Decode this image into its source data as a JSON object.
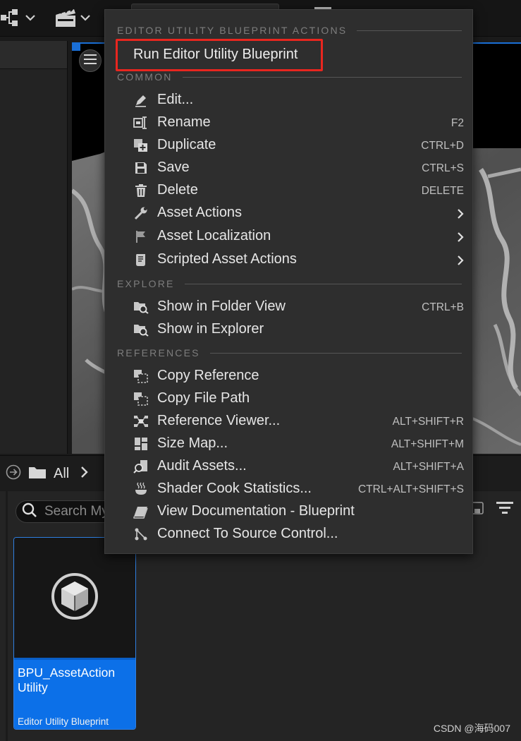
{
  "toolbar": {
    "blueprint_icon": "blueprint-graph-icon",
    "cinematics_icon": "clapperboard-icon"
  },
  "viewport": {
    "menu_icon": "hamburger-menu-icon"
  },
  "context_menu": {
    "sections": {
      "editor_utility": "EDITOR UTILITY BLUEPRINT ACTIONS",
      "common": "COMMON",
      "explore": "EXPLORE",
      "references": "REFERENCES"
    },
    "run_item": {
      "label": "Run Editor Utility Blueprint",
      "highlight_color": "#e8261f"
    },
    "common_items": [
      {
        "label": "Edit...",
        "shortcut": "",
        "icon": "pencil-icon"
      },
      {
        "label": "Rename",
        "shortcut": "F2",
        "icon": "rename-icon"
      },
      {
        "label": "Duplicate",
        "shortcut": "CTRL+D",
        "icon": "duplicate-icon"
      },
      {
        "label": "Save",
        "shortcut": "CTRL+S",
        "icon": "save-icon"
      },
      {
        "label": "Delete",
        "shortcut": "DELETE",
        "icon": "trash-icon"
      },
      {
        "label": "Asset Actions",
        "shortcut": "",
        "icon": "wrench-icon",
        "submenu": true
      },
      {
        "label": "Asset Localization",
        "shortcut": "",
        "icon": "flag-icon",
        "submenu": true
      },
      {
        "label": "Scripted Asset Actions",
        "shortcut": "",
        "icon": "script-icon",
        "submenu": true
      }
    ],
    "explore_items": [
      {
        "label": "Show in Folder View",
        "shortcut": "CTRL+B",
        "icon": "folder-search-icon"
      },
      {
        "label": "Show in Explorer",
        "shortcut": "",
        "icon": "folder-search-icon"
      }
    ],
    "reference_items": [
      {
        "label": "Copy Reference",
        "shortcut": "",
        "icon": "copy-reference-icon"
      },
      {
        "label": "Copy File Path",
        "shortcut": "",
        "icon": "copy-path-icon"
      },
      {
        "label": "Reference Viewer...",
        "shortcut": "ALT+SHIFT+R",
        "icon": "reference-viewer-icon"
      },
      {
        "label": "Size Map...",
        "shortcut": "ALT+SHIFT+M",
        "icon": "size-map-icon"
      },
      {
        "label": "Audit Assets...",
        "shortcut": "ALT+SHIFT+A",
        "icon": "audit-icon"
      },
      {
        "label": "Shader Cook Statistics...",
        "shortcut": "CTRL+ALT+SHIFT+S",
        "icon": "shader-cook-icon"
      },
      {
        "label": "View Documentation - Blueprint",
        "shortcut": "",
        "icon": "documentation-icon"
      },
      {
        "label": "Connect To Source Control...",
        "shortcut": "",
        "icon": "source-control-icon"
      }
    ]
  },
  "content_browser": {
    "path_label": "All",
    "search_placeholder": "Search My",
    "asset": {
      "name": "BPU_AssetAction Utility",
      "type": "Editor Utility Blueprint",
      "accent": "#0c70e8"
    }
  },
  "watermark": "CSDN @海码007"
}
